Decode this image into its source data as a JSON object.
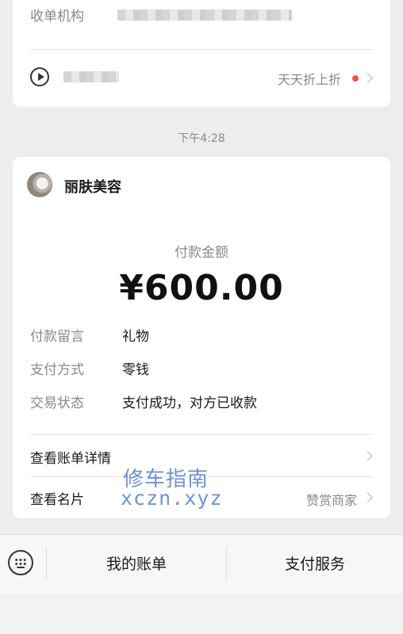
{
  "top_card": {
    "acquirer_label": "收单机构",
    "promo_link": "天天折上折"
  },
  "timestamp": "下午4:28",
  "payment_card": {
    "merchant_name": "丽肤美容",
    "amount_label": "付款金额",
    "amount": "¥600.00",
    "details": [
      {
        "label": "付款留言",
        "value": "礼物"
      },
      {
        "label": "支付方式",
        "value": "零钱"
      },
      {
        "label": "交易状态",
        "value": "支付成功，对方已收款"
      }
    ],
    "view_bill_details": "查看账单详情",
    "view_card": "查看名片",
    "tip_merchant": "赞赏商家"
  },
  "watermark": {
    "line1": "修车指南",
    "line2": "xczn.xyz"
  },
  "bottom_bar": {
    "my_bill": "我的账单",
    "pay_service": "支付服务"
  },
  "colors": {
    "background": "#ededed",
    "card": "#ffffff",
    "red_dot": "#fa5151",
    "watermark": "#3c6ec8"
  }
}
